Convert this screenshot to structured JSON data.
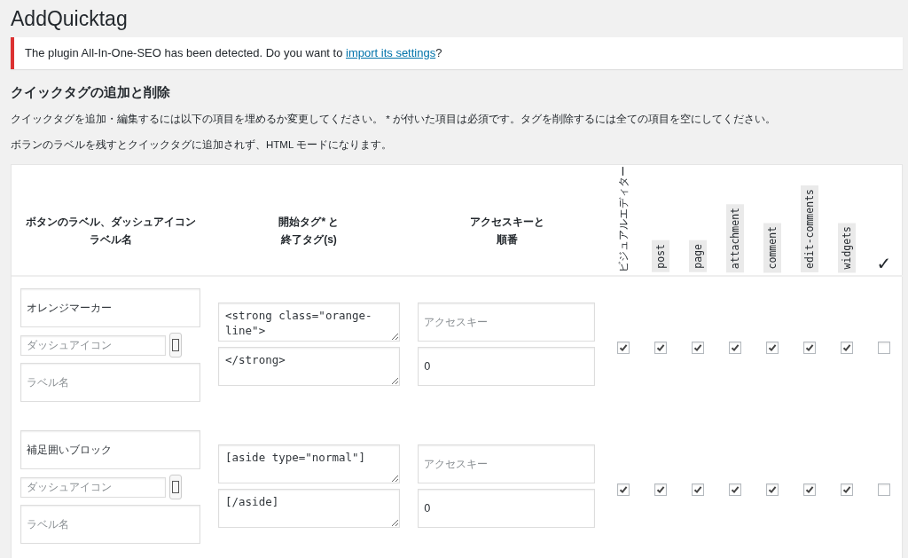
{
  "page_title": "AddQuicktag",
  "notice": {
    "text_before": "The plugin All-In-One-SEO has been detected. Do you want to ",
    "link": "import its settings",
    "text_after": "?"
  },
  "section_heading": "クイックタグの追加と削除",
  "descriptions": [
    "クイックタグを追加・編集するには以下の項目を埋めるか変更してください。 * が付いた項目は必須です。タグを削除するには全ての項目を空にしてください。",
    "ボランのラベルを残すとクイックタグに追加されず、HTML モードになります。"
  ],
  "table": {
    "columns": [
      {
        "kind": "text",
        "lines": [
          "ボタンのラベル、ダッシュアイコン",
          "ラベル名"
        ]
      },
      {
        "kind": "text",
        "lines": [
          "開始タグ* と",
          "終了タグ(s)"
        ]
      },
      {
        "kind": "text",
        "lines": [
          "アクセスキーと",
          "順番"
        ]
      },
      {
        "kind": "vertical",
        "label": "ビジュアルエディター"
      },
      {
        "kind": "code",
        "label": "post"
      },
      {
        "kind": "code",
        "label": "page"
      },
      {
        "kind": "code",
        "label": "attachment"
      },
      {
        "kind": "code",
        "label": "comment"
      },
      {
        "kind": "code",
        "label": "edit-comments"
      },
      {
        "kind": "code",
        "label": "widgets"
      },
      {
        "kind": "check",
        "label": "✓"
      }
    ],
    "rows": [
      {
        "label": "オレンジマーカー",
        "dashicon_placeholder": "ダッシュアイコン",
        "label_name_placeholder": "ラベル名",
        "open_tag": "<strong class=\"orange-line\">",
        "close_tag": "</strong>",
        "access_key_placeholder": "アクセスキー",
        "order": "0",
        "checks": [
          {
            "checked": true
          },
          {
            "checked": true
          },
          {
            "checked": true
          },
          {
            "checked": true
          },
          {
            "checked": true
          },
          {
            "checked": true
          },
          {
            "checked": true
          },
          {
            "checked": false
          }
        ]
      },
      {
        "label": "補足囲いブロック",
        "dashicon_placeholder": "ダッシュアイコン",
        "label_name_placeholder": "ラベル名",
        "open_tag": "[aside type=\"normal\"]",
        "close_tag": "[/aside]",
        "access_key_placeholder": "アクセスキー",
        "order": "0",
        "checks": [
          {
            "checked": true
          },
          {
            "checked": true
          },
          {
            "checked": true
          },
          {
            "checked": true
          },
          {
            "checked": true
          },
          {
            "checked": true
          },
          {
            "checked": true
          },
          {
            "checked": false
          }
        ]
      }
    ]
  }
}
